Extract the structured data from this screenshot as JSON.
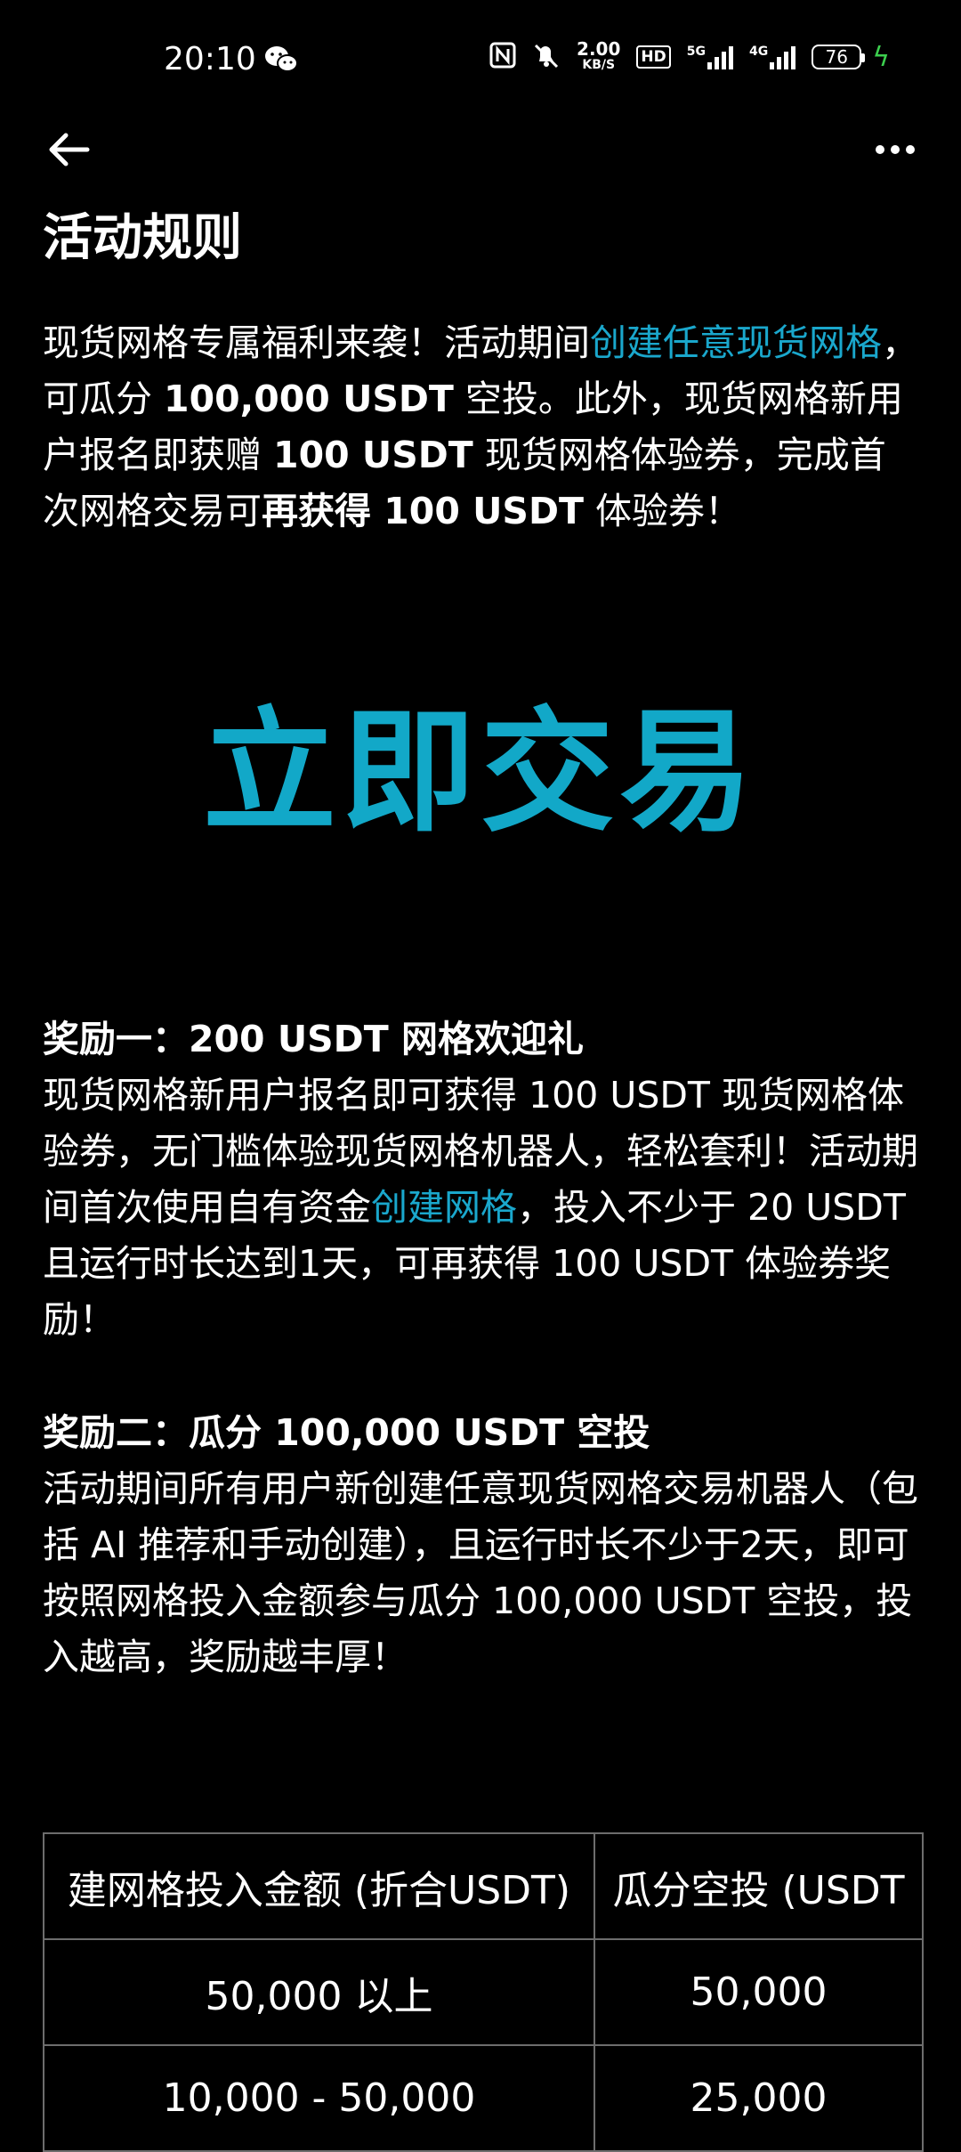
{
  "status_bar": {
    "time": "20:10",
    "speed_value": "2.00",
    "speed_unit": "KB/S",
    "hd_badge": "HD",
    "net1": "5G",
    "net2": "4G",
    "battery": "76"
  },
  "nav": {
    "back_icon": "arrow-left-icon",
    "more_icon": "more-dots-icon"
  },
  "page_title": "活动规则",
  "intro": {
    "t1": "现货网格专属福利来袭！活动期间",
    "link": "创建任意现货网格",
    "t2": "，可瓜分 ",
    "b1": "100,000 USDT",
    "t3": " 空投。此外，现货网格新用户报名即获赠 ",
    "b2": "100 USDT",
    "t4": " 现货网格体验券，完成首次网格交易可",
    "b3": "再获得 100 USDT",
    "t5": " 体验券！"
  },
  "cta_label": "立即交易",
  "reward1": {
    "prefix": "奖励一：",
    "title": "200 USDT 网格欢迎礼",
    "t1": "现货网格新用户报名即可获得 100 USDT 现货网格体验券，无门槛体验现货网格机器人，轻松套利！活动期间首次使用自有资金",
    "link": "创建网格",
    "t2": "，投入不少于 20 USDT 且运行时长达到1天，可再获得 100 USDT 体验券奖励！"
  },
  "reward2": {
    "prefix": "奖励二：",
    "title": "瓜分 100,000 USDT 空投",
    "body": "活动期间所有用户新创建任意现货网格交易机器人（包括 AI 推荐和手动创建），且运行时长不少于2天，即可按照网格投入金额参与瓜分 100,000 USDT 空投，投入越高，奖励越丰厚！"
  },
  "table": {
    "headers": [
      "建网格投入金额 (折合USDT)",
      "瓜分空投 (USDT"
    ],
    "rows": [
      [
        "50,000 以上",
        "50,000"
      ],
      [
        "10,000 - 50,000",
        "25,000"
      ]
    ]
  },
  "colors": {
    "background": "#000000",
    "accent": "#12a8c8",
    "link": "#1aa7cc",
    "table_border": "#6d6d6d"
  }
}
